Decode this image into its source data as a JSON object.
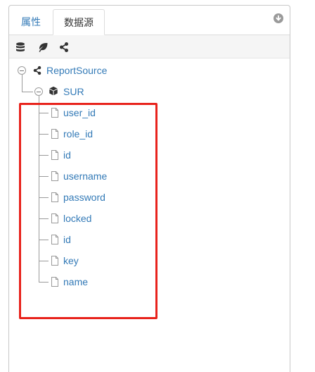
{
  "tabs": [
    {
      "label": "属性",
      "active": false
    },
    {
      "label": "数据源",
      "active": true
    }
  ],
  "toolbar": {
    "icons": [
      "database-icon",
      "leaf-icon",
      "share-icon"
    ]
  },
  "tree": {
    "root": {
      "label": "ReportSource",
      "icon": "share-icon",
      "expanded": true
    },
    "table": {
      "label": "SUR",
      "icon": "cube-icon",
      "expanded": true
    },
    "fields": [
      "user_id",
      "role_id",
      "id",
      "username",
      "password",
      "locked",
      "id",
      "key",
      "name"
    ]
  },
  "colors": {
    "link": "#337ab7",
    "highlight": "#e8231c",
    "toolbar_bg": "#f5f5f5"
  }
}
